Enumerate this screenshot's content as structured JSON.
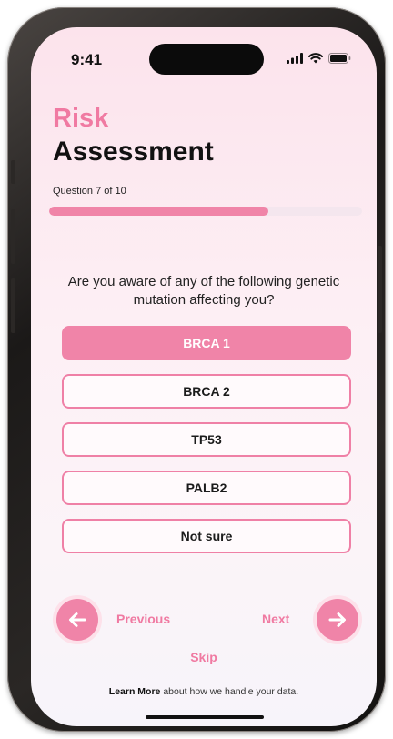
{
  "status_bar": {
    "time": "9:41",
    "icons": [
      "signal-icon",
      "wifi-icon",
      "battery-icon"
    ]
  },
  "header": {
    "title_accent": "Risk",
    "title_main": "Assessment"
  },
  "progress": {
    "label": "Question 7 of 10",
    "current": 7,
    "total": 10,
    "fraction": 0.7
  },
  "question": {
    "text": "Are you aware of any of the following genetic mutation affecting you?"
  },
  "options": [
    {
      "label": "BRCA 1",
      "selected": true
    },
    {
      "label": "BRCA 2",
      "selected": false
    },
    {
      "label": "TP53",
      "selected": false
    },
    {
      "label": "PALB2",
      "selected": false
    },
    {
      "label": "Not sure",
      "selected": false
    }
  ],
  "navigation": {
    "previous_label": "Previous",
    "next_label": "Next",
    "skip_label": "Skip"
  },
  "footer": {
    "learn_more": "Learn More",
    "learn_more_rest": " about how we handle your data."
  },
  "colors": {
    "accent": "#f084a8",
    "accent_text": "#f07aa2",
    "title": "#111111"
  }
}
